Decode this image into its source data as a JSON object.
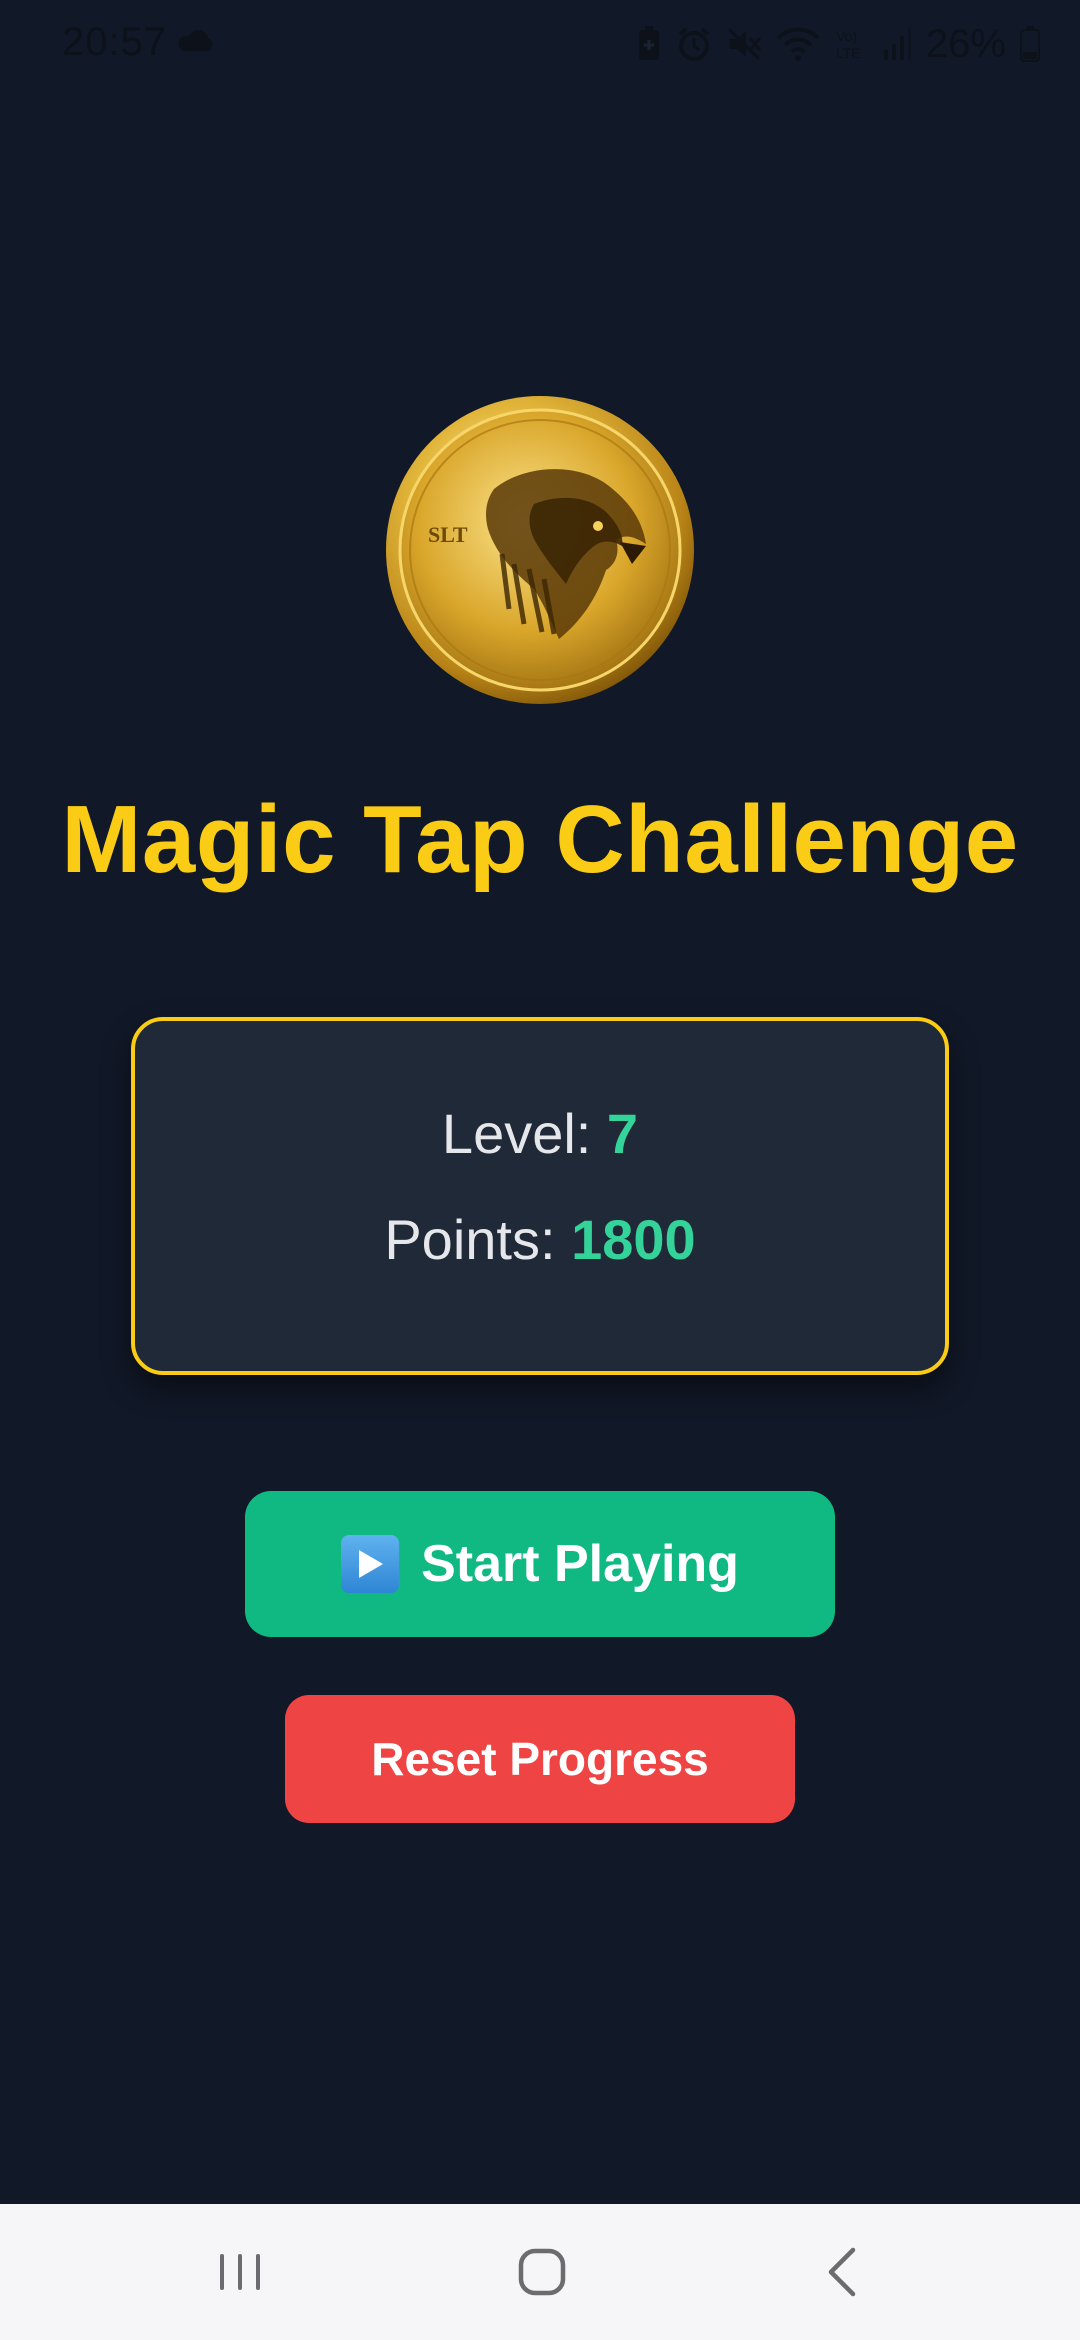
{
  "status_bar": {
    "time": "20:57",
    "battery": "26%",
    "icons": [
      "cloud-icon",
      "battery-saver-icon",
      "alarm-icon",
      "mute-icon",
      "wifi-icon",
      "volte-icon",
      "signal-icon",
      "battery-icon"
    ]
  },
  "app": {
    "logo": "eagle-coin-logo",
    "title": "Magic Tap Challenge"
  },
  "stats": {
    "level_label": "Level: ",
    "level_value": "7",
    "points_label": "Points: ",
    "points_value": "1800"
  },
  "buttons": {
    "start_label": "Start Playing",
    "start_icon": "play-icon",
    "reset_label": "Reset Progress"
  },
  "nav": {
    "items": [
      "recents-icon",
      "home-icon",
      "back-icon"
    ]
  },
  "colors": {
    "background": "#111827",
    "accent": "#facc15",
    "card": "#1f2937",
    "value": "#34d399",
    "start": "#10b981",
    "reset": "#ef4444"
  }
}
